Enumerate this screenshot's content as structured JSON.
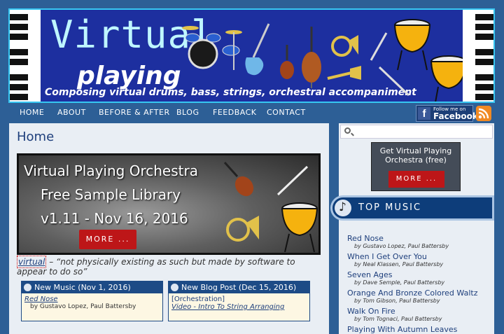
{
  "banner": {
    "title_line1": "Virtual",
    "title_line2": "playing",
    "tagline": "Composing virtual drums, bass, strings, orchestral accompaniment"
  },
  "nav": {
    "items": [
      "HOME",
      "ABOUT",
      "BEFORE & AFTER",
      "BLOG",
      "FEEDBACK",
      "CONTACT"
    ]
  },
  "social": {
    "facebook_top": "Follow me on",
    "facebook_bottom": "Facebook",
    "facebook_glyph": "f"
  },
  "main": {
    "page_title": "Home",
    "hero": {
      "line1": "Virtual Playing Orchestra",
      "line2": "Free Sample Library",
      "line3": "v1.11 - Nov 16, 2016",
      "button": "MORE ..."
    },
    "definition": {
      "word": "virtual",
      "dash": " – ",
      "quote": "“not physically existing as such but made by software to appear to do so”"
    },
    "boxes": [
      {
        "header": "New Music (Nov 1, 2016)",
        "line1": "Red Nose",
        "line2": "by Gustavo Lopez, Paul Battersby"
      },
      {
        "header": "New Blog Post (Dec 15, 2016)",
        "line1": "[Orchestration]",
        "line2": "Video - Intro To String Arranging"
      }
    ]
  },
  "sidebar": {
    "search_placeholder": "",
    "promo_title": "Get Virtual Playing Orchestra (free)",
    "promo_button": "MORE ...",
    "top_music_title": "TOP MUSIC",
    "songs": [
      {
        "name": "Red Nose",
        "artists": "by Gustavo Lopez, Paul Battersby"
      },
      {
        "name": "When I Get Over You",
        "artists": "by Neal Klassen, Paul Battersby"
      },
      {
        "name": "Seven Ages",
        "artists": "by Dave Semple, Paul Battersby"
      },
      {
        "name": "Orange And Bronze Colored Waltz",
        "artists": "by Tom Gibson, Paul Battersby"
      },
      {
        "name": "Walk On Fire",
        "artists": "by Tom Tognaci, Paul Battersby"
      },
      {
        "name": "Playing With Autumn Leaves",
        "artists": ""
      }
    ]
  },
  "colors": {
    "page_bg": "#2d5f96",
    "banner_bg": "#1d2f9f",
    "accent_red": "#bd1618",
    "link_blue": "#1e3f7c"
  }
}
